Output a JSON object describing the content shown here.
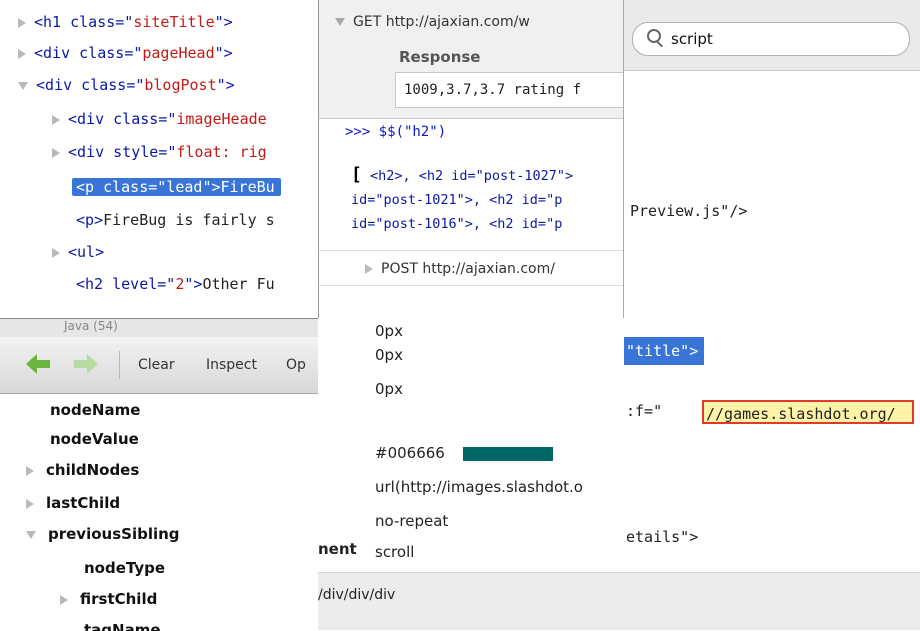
{
  "html_tree": {
    "lines": [
      {
        "indent": 0,
        "twisty": "right",
        "tag": "h1",
        "attr": "class",
        "val": "siteTitle",
        "close": ">",
        "text": ""
      },
      {
        "indent": 0,
        "twisty": "right",
        "tag": "div",
        "attr": "class",
        "val": "pageHead",
        "close": ">",
        "text": ""
      },
      {
        "indent": 0,
        "twisty": "down",
        "tag": "div",
        "attr": "class",
        "val": "blogPost",
        "close": ">",
        "text": ""
      },
      {
        "indent": 1,
        "twisty": "right",
        "tag": "div",
        "attr": "class",
        "val": "imageHeade",
        "close": "",
        "text": ""
      },
      {
        "indent": 1,
        "twisty": "right",
        "tag": "div",
        "attr": "style",
        "val": "float: rig",
        "close": "",
        "text": ""
      },
      {
        "indent": 1,
        "twisty": "none",
        "tag": "p",
        "attr": "class",
        "val": "lead",
        "close": ">",
        "text": "FireBu"
      },
      {
        "indent": 1,
        "twisty": "none",
        "tag": "p",
        "attr": "",
        "val": "",
        "close": ">",
        "text": "FireBug is fairly s"
      },
      {
        "indent": 1,
        "twisty": "right",
        "tag": "ul",
        "attr": "",
        "val": "",
        "close": ">",
        "text": ""
      },
      {
        "indent": 1,
        "twisty": "none",
        "tag": "h2",
        "attr": "level",
        "val": "2",
        "close": ">",
        "text": "Other Fu"
      }
    ]
  },
  "console": {
    "get_request": "GET http://ajaxian.com/w",
    "response_label": "Response",
    "response_value": "1009,3.7,3.7 rating f",
    "command": ">>> $$(\"h2\")",
    "result_lines": [
      "<h2>, <h2 id=\"post-1027\">",
      "id=\"post-1021\">, <h2 id=\"p",
      "id=\"post-1016\">, <h2 id=\"p"
    ],
    "post_request": "POST http://ajaxian.com/"
  },
  "search_panel": {
    "search_value": "script",
    "source_lines": [
      {
        "text": "Preview.js\"/>"
      },
      {
        "text": "\"title\">"
      },
      {
        "text": ":f=\""
      },
      {
        "text": "//games.slashdot.org/"
      },
      {
        "text": "etails\">"
      }
    ]
  },
  "dom_panel": {
    "java_label": "Java (54)",
    "toolbar": {
      "clear": "Clear",
      "inspect": "Inspect",
      "options_partial": "Op"
    },
    "rows": [
      {
        "label": "nodeName",
        "twisty": "none",
        "indent": 0
      },
      {
        "label": "nodeValue",
        "twisty": "none",
        "indent": 0
      },
      {
        "label": "childNodes",
        "twisty": "right",
        "indent": 0
      },
      {
        "label": "lastChild",
        "twisty": "right",
        "indent": 0
      },
      {
        "label": "previousSibling",
        "twisty": "down",
        "indent": 0
      },
      {
        "label": "nodeType",
        "twisty": "none",
        "indent": 1
      },
      {
        "label": "firstChild",
        "twisty": "right",
        "indent": 1
      },
      {
        "label": "tagName",
        "twisty": "none",
        "indent": 1
      }
    ]
  },
  "css_panel": {
    "values": [
      "0px",
      "0px",
      "0px",
      "#006666",
      "url(http://images.slashdot.o",
      "no-repeat",
      "scroll"
    ],
    "swatch_color": "#006666",
    "partial_label": "nent",
    "xpath": "/div/div/div"
  }
}
